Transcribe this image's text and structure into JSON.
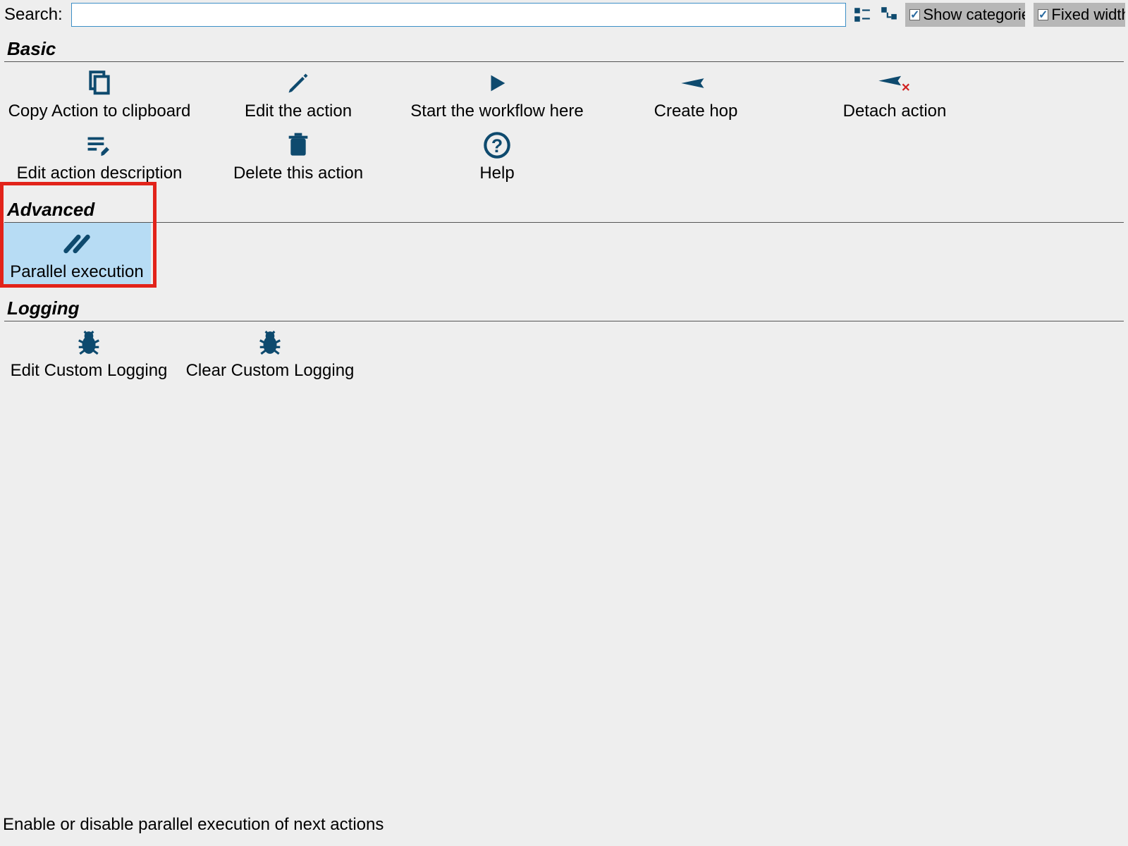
{
  "search": {
    "label": "Search:",
    "value": ""
  },
  "toggles": {
    "show_categories": {
      "label": "Show categories",
      "checked": true
    },
    "fixed_width": {
      "label": "Fixed width",
      "checked": true
    }
  },
  "sections": {
    "basic": {
      "title": "Basic",
      "items": [
        {
          "label": "Copy Action to clipboard",
          "icon": "copy"
        },
        {
          "label": "Edit the action",
          "icon": "pencil"
        },
        {
          "label": "Start the workflow here",
          "icon": "play"
        },
        {
          "label": "Create hop",
          "icon": "arrow"
        },
        {
          "label": "Detach action",
          "icon": "arrow-x"
        },
        {
          "label": "Edit action description",
          "icon": "edit-lines"
        },
        {
          "label": "Delete this action",
          "icon": "trash"
        },
        {
          "label": "Help",
          "icon": "help"
        }
      ]
    },
    "advanced": {
      "title": "Advanced",
      "items": [
        {
          "label": "Parallel execution",
          "icon": "parallel",
          "selected": true
        }
      ]
    },
    "logging": {
      "title": "Logging",
      "items": [
        {
          "label": "Edit Custom Logging",
          "icon": "bug"
        },
        {
          "label": "Clear Custom Logging",
          "icon": "bug"
        }
      ]
    }
  },
  "status_text": "Enable or disable parallel execution of next actions",
  "highlight": {
    "section": "advanced",
    "item_index": 0
  }
}
